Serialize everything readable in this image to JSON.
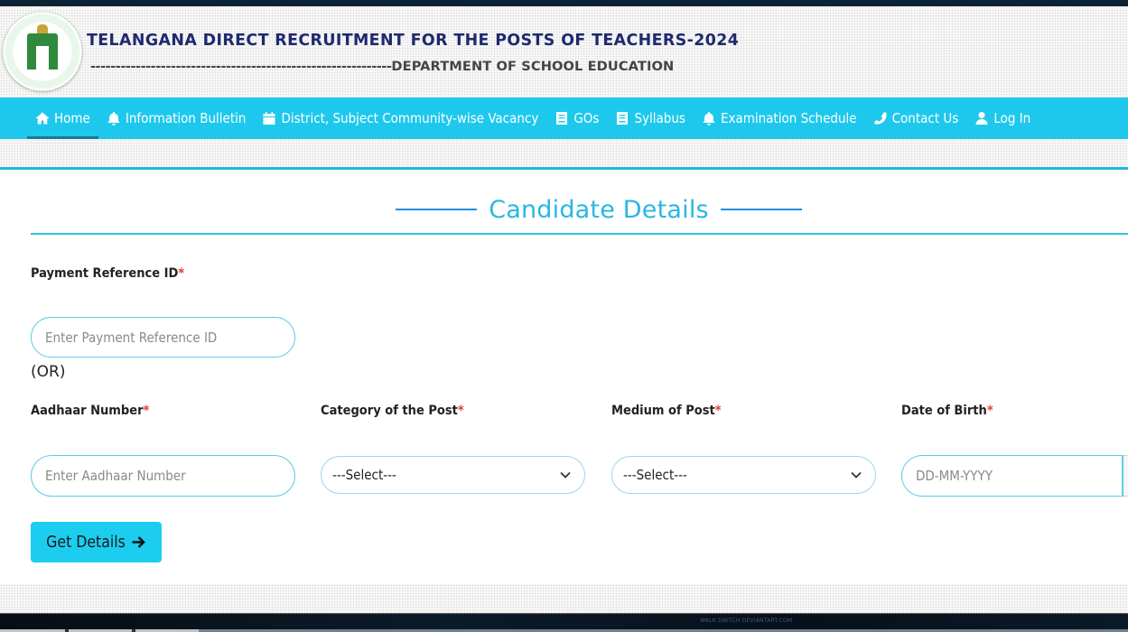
{
  "header": {
    "title": "TELANGANA DIRECT RECRUITMENT FOR THE POSTS OF TEACHERS-2024",
    "subtitle_dashes": "------------------------------------------------------------",
    "subtitle": "DEPARTMENT OF SCHOOL EDUCATION",
    "emblem": "government-of-telangana-emblem"
  },
  "nav": {
    "items": [
      {
        "label": "Home",
        "icon": "home-icon",
        "active": true
      },
      {
        "label": "Information Bulletin",
        "icon": "bell-icon"
      },
      {
        "label": "District, Subject Community-wise Vacancy",
        "icon": "calendar-icon"
      },
      {
        "label": "GOs",
        "icon": "book-icon"
      },
      {
        "label": "Syllabus",
        "icon": "book-icon"
      },
      {
        "label": "Examination Schedule",
        "icon": "bell-icon"
      },
      {
        "label": "Contact Us",
        "icon": "phone-icon"
      },
      {
        "label": "Log In",
        "icon": "user-icon"
      }
    ]
  },
  "form": {
    "section_title": "Candidate Details",
    "required_marker": "*",
    "payment_reference": {
      "label": "Payment Reference ID",
      "placeholder": "Enter Payment Reference ID",
      "value": ""
    },
    "or_text": "(OR)",
    "aadhaar": {
      "label": "Aadhaar Number",
      "placeholder": "Enter Aadhaar Number",
      "value": ""
    },
    "category": {
      "label": "Category of the Post",
      "selected": "---Select---"
    },
    "medium": {
      "label": "Medium of Post",
      "selected": "---Select---"
    },
    "dob": {
      "label": "Date of Birth",
      "placeholder": "DD-MM-YYYY",
      "value": ""
    },
    "submit_label": "Get Details"
  },
  "colors": {
    "nav_bg": "#1ec8ed",
    "title_navy": "#1e2a6e",
    "section_title": "#29b7e0",
    "required": "#e53935",
    "button_bg": "#1ccdf0"
  },
  "footer": {
    "watermark": "WALK.SWITCH.DEVIANTART.COM"
  }
}
